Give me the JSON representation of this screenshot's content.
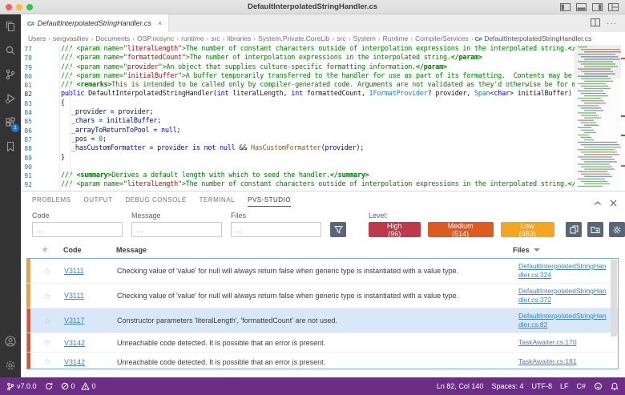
{
  "window": {
    "title": "DefaultInterpolatedStringHandler.cs"
  },
  "activity_bar": {
    "extensions_badge": "1"
  },
  "tab": {
    "title": "DefaultInterpolatedStringHandler.cs",
    "close": "×",
    "file_icon": "C#"
  },
  "tabbar_actions": {
    "more": "···"
  },
  "breadcrumb": {
    "items": [
      "Users",
      "sergvasiliev",
      "Documents",
      "OSP.nosync",
      "runtime",
      "src",
      "libraries",
      "System.Private.CoreLib",
      "src",
      "System",
      "Runtime",
      "CompilerServices",
      "DefaultInterpolatedStringHandler.cs"
    ]
  },
  "editor": {
    "lines": [
      {
        "num": "77",
        "ind": 2,
        "tokens": [
          [
            "cm",
            "/// <param name="
          ],
          [
            "str",
            "\"literalLength\""
          ],
          [
            "cm",
            ">The number of constant characters outside of interpolation expressions in the interpolated string."
          ],
          [
            "tagb",
            "</param>"
          ]
        ]
      },
      {
        "num": "78",
        "ind": 2,
        "tokens": [
          [
            "cm",
            "/// <param name="
          ],
          [
            "str",
            "\"formattedCount\""
          ],
          [
            "cm",
            ">The number of interpolation expressions in the interpolated string."
          ],
          [
            "tagb",
            "</param>"
          ]
        ]
      },
      {
        "num": "79",
        "ind": 2,
        "tokens": [
          [
            "cm",
            "/// <param name="
          ],
          [
            "str",
            "\"provider\""
          ],
          [
            "cm",
            ">An object that supplies culture-specific formatting information."
          ],
          [
            "tagb",
            "</param>"
          ]
        ]
      },
      {
        "num": "80",
        "ind": 2,
        "tokens": [
          [
            "cm",
            "/// <param name="
          ],
          [
            "str",
            "\"initialBuffer\""
          ],
          [
            "cm",
            ">A buffer temporarily transferred to the handler for use as part of its formatting.  Contents may be overwritten."
          ]
        ]
      },
      {
        "num": "81",
        "ind": 2,
        "tokens": [
          [
            "cm",
            "/// "
          ],
          [
            "tagb",
            "<remarks>"
          ],
          [
            "cm",
            "This is intended to be called only by compiler-generated code. Arguments are not validated as they'd otherwise be for members"
          ]
        ]
      },
      {
        "num": "82",
        "ind": 2,
        "active": true,
        "tokens": [
          [
            "kw",
            "public "
          ],
          [
            "pl",
            "DefaultInterpolatedStringHandler("
          ],
          [
            "kw",
            "int"
          ],
          [
            "pl",
            " literalLength, "
          ],
          [
            "kw",
            "int"
          ],
          [
            "pl",
            " formattedCount, "
          ],
          [
            "ty",
            "IFormatProvider"
          ],
          [
            "kw",
            "?"
          ],
          [
            "pl",
            " provider, "
          ],
          [
            "ty",
            "Span"
          ],
          [
            "pl",
            "<"
          ],
          [
            "kw",
            "char"
          ],
          [
            "pl",
            "> initialBuffer)"
          ]
        ]
      },
      {
        "num": "83",
        "ind": 2,
        "tokens": [
          [
            "pl",
            "{"
          ]
        ]
      },
      {
        "num": "84",
        "ind": 3,
        "tokens": [
          [
            "fld",
            "_provider"
          ],
          [
            "pl",
            " = "
          ],
          [
            "fld",
            "provider"
          ],
          [
            "pl",
            ";"
          ]
        ]
      },
      {
        "num": "85",
        "ind": 3,
        "tokens": [
          [
            "fld",
            "_chars"
          ],
          [
            "pl",
            " = "
          ],
          [
            "fld",
            "initialBuffer"
          ],
          [
            "pl",
            ";"
          ]
        ]
      },
      {
        "num": "86",
        "ind": 3,
        "tokens": [
          [
            "fld",
            "_arrayToReturnToPool"
          ],
          [
            "pl",
            " = "
          ],
          [
            "kw",
            "null"
          ],
          [
            "pl",
            ";"
          ]
        ]
      },
      {
        "num": "87",
        "ind": 3,
        "tokens": [
          [
            "fld",
            "_pos"
          ],
          [
            "pl",
            " = "
          ],
          [
            "num",
            "0"
          ],
          [
            "pl",
            ";"
          ]
        ]
      },
      {
        "num": "88",
        "ind": 3,
        "tokens": [
          [
            "fld",
            "_hasCustomFormatter"
          ],
          [
            "pl",
            " = "
          ],
          [
            "fld",
            "provider"
          ],
          [
            "pl",
            " "
          ],
          [
            "kw",
            "is not null"
          ],
          [
            "pl",
            " && "
          ],
          [
            "mth",
            "HasCustomFormatter"
          ],
          [
            "pl",
            "("
          ],
          [
            "fld",
            "provider"
          ],
          [
            "pl",
            ");"
          ]
        ]
      },
      {
        "num": "89",
        "ind": 2,
        "tokens": [
          [
            "pl",
            "}"
          ]
        ]
      },
      {
        "num": "90",
        "ind": 2,
        "tokens": []
      },
      {
        "num": "91",
        "ind": 2,
        "tokens": [
          [
            "cm",
            "/// "
          ],
          [
            "tagb",
            "<summary>"
          ],
          [
            "cm",
            "Derives a default length with which to seed the handler."
          ],
          [
            "tagb",
            "</summary>"
          ]
        ]
      },
      {
        "num": "92",
        "ind": 2,
        "tokens": [
          [
            "cm",
            "/// <param name="
          ],
          [
            "str",
            "\"literalLength\""
          ],
          [
            "cm",
            ">The number of constant characters outside of interpolation expressions in the interpolated string."
          ],
          [
            "tagb",
            "</p"
          ]
        ]
      }
    ]
  },
  "panel": {
    "tabs": [
      {
        "label": "PROBLEMS",
        "active": false
      },
      {
        "label": "OUTPUT",
        "active": false
      },
      {
        "label": "DEBUG CONSOLE",
        "active": false
      },
      {
        "label": "TERMINAL",
        "active": false
      },
      {
        "label": "PVS-STUDIO",
        "active": true
      }
    ],
    "filters": [
      {
        "label": "Code",
        "placeholder": "..."
      },
      {
        "label": "Message",
        "placeholder": "..."
      },
      {
        "label": "Files",
        "placeholder": "..."
      }
    ],
    "level_label": "Level:",
    "levels": [
      {
        "label": "High (96)",
        "color": "#BE3A4A"
      },
      {
        "label": "Medium (514)",
        "color": "#DC5B21"
      },
      {
        "label": "Low (483)",
        "color": "#F4A523"
      }
    ],
    "table": {
      "header": {
        "code": "Code",
        "message": "Message",
        "files": "Files"
      },
      "rows": [
        {
          "code": "V3111",
          "message": "Checking value of 'value' for null will always return false when generic type is instantiated with a value type.",
          "file": "DefaultInterpolatedStringHandler.cs:324",
          "strip": "#F2A33C",
          "selected": false
        },
        {
          "code": "V3111",
          "message": "Checking value of 'value' for null will always return false when generic type is instantiated with a value type.",
          "file": "DefaultInterpolatedStringHandler.cs:372",
          "strip": "#F2A33C",
          "selected": false
        },
        {
          "code": "V3117",
          "message": "Constructor parameters 'literalLength', 'formattedCount' are not used.",
          "file": "DefaultInterpolatedStringHandler.cs:82",
          "strip": "#E0502D",
          "selected": true
        },
        {
          "code": "V3142",
          "message": "Unreachable code detected. It is possible that an error is present.",
          "file": "TaskAwaiter.cs:170",
          "strip": "#E0502D",
          "selected": false
        },
        {
          "code": "V3142",
          "message": "Unreachable code detected. It is possible that an error is present.",
          "file": "TaskAwaiter.cs:181",
          "strip": "#E0502D",
          "selected": false
        }
      ]
    }
  },
  "status_bar": {
    "version": "v7.0.0",
    "errors": "0",
    "warnings": "0",
    "position": "Ln 82, Col 140",
    "indent": "Spaces: 4",
    "encoding": "UTF-8",
    "eol": "LF",
    "language": "C#"
  }
}
